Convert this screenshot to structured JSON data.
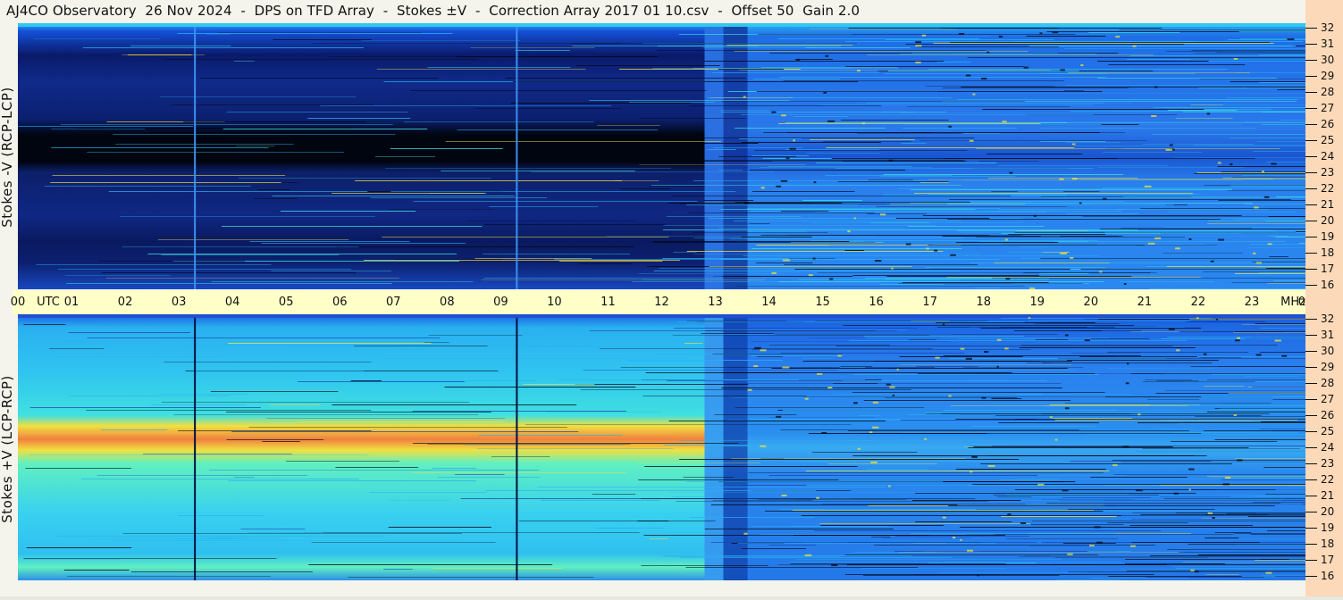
{
  "title": "AJ4CO Observatory  26 Nov 2024  -  DPS on TFD Array  -  Stokes ±V  -  Correction Array 2017 01 10.csv  -  Offset 50  Gain 2.0",
  "chart_data": [
    {
      "type": "heatmap",
      "ylabel": "Stokes -V (RCP-LCP)",
      "x_ticks": [
        "00",
        "UTC",
        "01",
        "02",
        "03",
        "04",
        "05",
        "06",
        "07",
        "08",
        "09",
        "10",
        "11",
        "12",
        "13",
        "14",
        "15",
        "16",
        "17",
        "18",
        "19",
        "20",
        "21",
        "22",
        "23",
        "00"
      ],
      "x_unit": "UTC",
      "y_ticks": [
        16,
        17,
        18,
        19,
        20,
        21,
        22,
        23,
        24,
        25,
        26,
        27,
        28,
        29,
        30,
        31,
        32
      ],
      "y_unit": "MHz",
      "ylim": [
        16,
        32
      ],
      "colormap": "jet",
      "features": [
        {
          "kind": "dark_band",
          "freq_range": [
            23.6,
            25.1
          ],
          "time_range": [
            0,
            12.8
          ]
        },
        {
          "kind": "vertical_line",
          "time": 3.3
        },
        {
          "kind": "vertical_line",
          "time": 9.3
        }
      ]
    },
    {
      "type": "heatmap",
      "ylabel": "Stokes +V (LCP-RCP)",
      "x_ticks": [
        "00",
        "UTC",
        "01",
        "02",
        "03",
        "04",
        "05",
        "06",
        "07",
        "08",
        "09",
        "10",
        "11",
        "12",
        "13",
        "14",
        "15",
        "16",
        "17",
        "18",
        "19",
        "20",
        "21",
        "22",
        "23",
        "00"
      ],
      "x_unit": "UTC",
      "y_ticks": [
        16,
        17,
        18,
        19,
        20,
        21,
        22,
        23,
        24,
        25,
        26,
        27,
        28,
        29,
        30,
        31,
        32
      ],
      "y_unit": "MHz",
      "ylim": [
        16,
        32
      ],
      "colormap": "jet",
      "features": [
        {
          "kind": "bright_band",
          "freq_range": [
            23.6,
            25.1
          ],
          "time_range": [
            0,
            12.8
          ]
        },
        {
          "kind": "vertical_line",
          "time": 3.3
        },
        {
          "kind": "vertical_line",
          "time": 9.3
        }
      ]
    }
  ],
  "utc_axis": {
    "labels": [
      "00",
      "UTC",
      "01",
      "02",
      "03",
      "04",
      "05",
      "06",
      "07",
      "08",
      "09",
      "10",
      "11",
      "12",
      "13",
      "14",
      "15",
      "16",
      "17",
      "18",
      "19",
      "20",
      "21",
      "22",
      "23",
      "00",
      "MHz"
    ]
  },
  "freq_axis": {
    "labels": [
      "32",
      "31",
      "30",
      "29",
      "28",
      "27",
      "26",
      "25",
      "24",
      "23",
      "22",
      "21",
      "20",
      "19",
      "18",
      "17",
      "16"
    ]
  },
  "colors": {
    "background": "#f4f4ec",
    "utc_strip": "#ffffc8",
    "freq_strip": "#fcd9b8",
    "deep": "#000510",
    "dark_blue": "#0a1a6a",
    "blue": "#1450d8",
    "light_blue": "#2ab0f0",
    "cyan": "#40e0e0",
    "yellow": "#f0e040",
    "orange": "#f08040"
  }
}
